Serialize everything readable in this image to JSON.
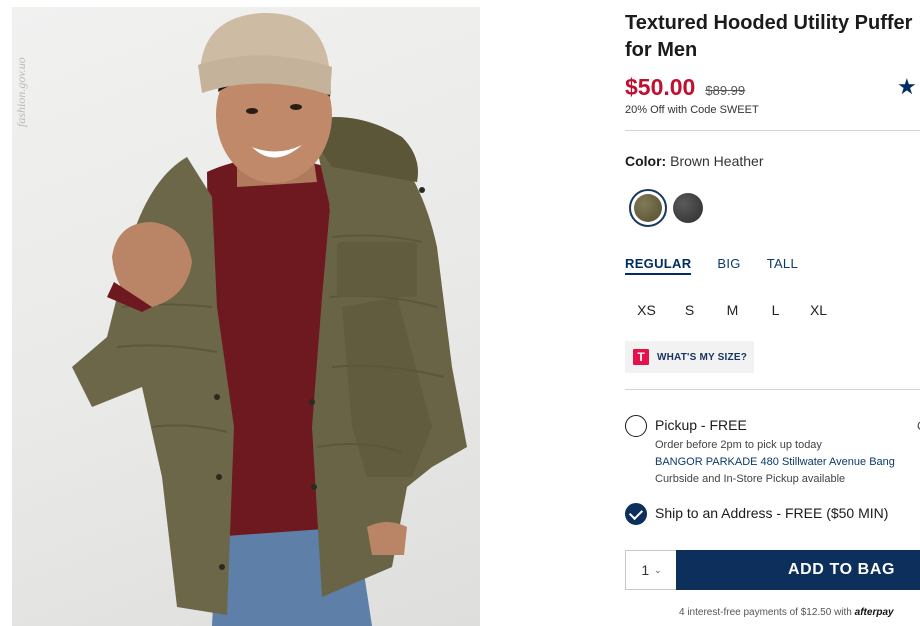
{
  "photo": {
    "watermark": "fashion.gov.uo"
  },
  "product": {
    "title": "Textured Hooded Utility Puffer for Men",
    "price": "$50.00",
    "original_price": "$89.99",
    "promo": "20% Off with Code SWEET",
    "rating_icon": "star-icon"
  },
  "color": {
    "label": "Color:",
    "selected": "Brown Heather",
    "swatches": [
      {
        "name": "Brown Heather",
        "hex": "#6b6445",
        "selected": true
      },
      {
        "name": "Charcoal",
        "hex": "#404040",
        "selected": false
      }
    ]
  },
  "fits": [
    {
      "label": "REGULAR",
      "active": true
    },
    {
      "label": "BIG",
      "active": false
    },
    {
      "label": "TALL",
      "active": false
    }
  ],
  "sizes": [
    "XS",
    "S",
    "M",
    "L",
    "XL"
  ],
  "size_help": {
    "icon": "T",
    "label": "WHAT'S MY SIZE?"
  },
  "fulfillment": {
    "pickup": {
      "title": "Pickup - FREE",
      "note": "Order before 2pm to pick up today",
      "store": "BANGOR PARKADE 480 Stillwater Avenue Bang",
      "curbside": "Curbside and In-Store Pickup available",
      "extra": "C",
      "selected": false
    },
    "ship": {
      "title": "Ship to an Address - FREE ($50 MIN)",
      "selected": true
    }
  },
  "cart": {
    "quantity": "1",
    "add_label": "ADD TO BAG",
    "afterpay_text": "4 interest-free payments of $12.50 with",
    "afterpay_brand": "afterpay"
  },
  "colors": {
    "brand_navy": "#0d2f5c",
    "sale_red": "#c1102f",
    "size_icon_pink": "#e3124b"
  }
}
